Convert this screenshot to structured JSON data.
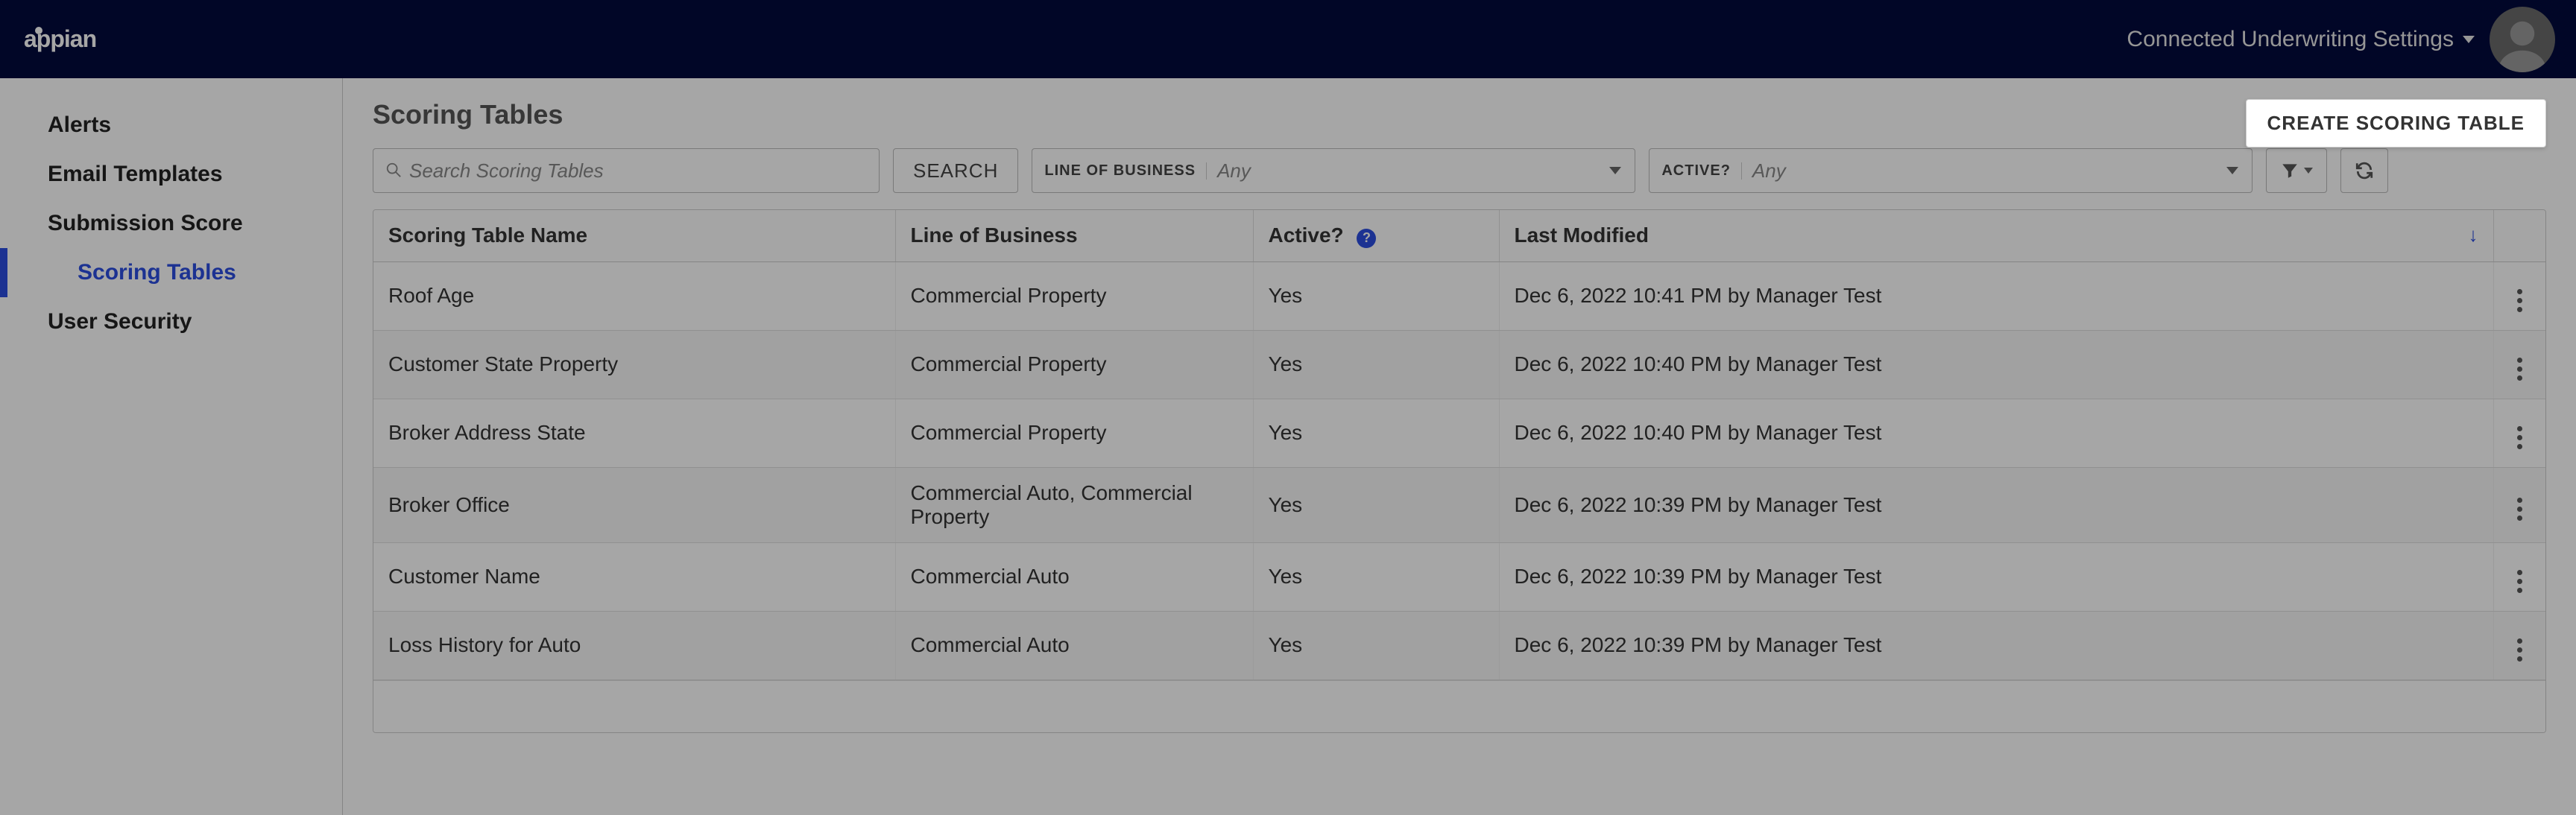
{
  "header": {
    "app_title": "Connected Underwriting Settings"
  },
  "sidebar": {
    "items": [
      {
        "label": "Alerts"
      },
      {
        "label": "Email Templates"
      },
      {
        "label": "Submission Score"
      },
      {
        "label": "Scoring Tables"
      },
      {
        "label": "User Security"
      }
    ]
  },
  "page": {
    "title": "Scoring Tables",
    "create_button": "CREATE SCORING TABLE"
  },
  "toolbar": {
    "search_placeholder": "Search Scoring Tables",
    "search_button": "SEARCH",
    "lob_label": "LINE OF BUSINESS",
    "lob_value": "Any",
    "active_label": "ACTIVE?",
    "active_value": "Any"
  },
  "table": {
    "columns": {
      "name": "Scoring Table Name",
      "lob": "Line of Business",
      "active": "Active?",
      "modified": "Last Modified"
    },
    "rows": [
      {
        "name": "Roof Age",
        "lob": "Commercial Property",
        "active": "Yes",
        "modified": "Dec 6, 2022 10:41 PM by Manager Test"
      },
      {
        "name": "Customer State Property",
        "lob": "Commercial Property",
        "active": "Yes",
        "modified": "Dec 6, 2022 10:40 PM by Manager Test"
      },
      {
        "name": "Broker Address State",
        "lob": "Commercial Property",
        "active": "Yes",
        "modified": "Dec 6, 2022 10:40 PM by Manager Test"
      },
      {
        "name": "Broker Office",
        "lob": "Commercial Auto, Commercial Property",
        "active": "Yes",
        "modified": "Dec 6, 2022 10:39 PM by Manager Test"
      },
      {
        "name": "Customer Name",
        "lob": "Commercial Auto",
        "active": "Yes",
        "modified": "Dec 6, 2022 10:39 PM by Manager Test"
      },
      {
        "name": "Loss History for Auto",
        "lob": "Commercial Auto",
        "active": "Yes",
        "modified": "Dec 6, 2022 10:39 PM by Manager Test"
      }
    ]
  }
}
